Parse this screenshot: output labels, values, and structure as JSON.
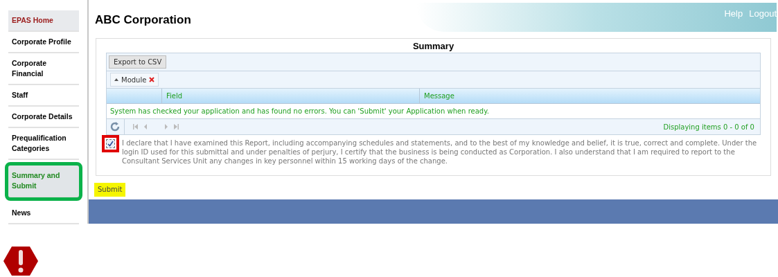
{
  "nav": [
    {
      "label": "EPAS Home",
      "kind": "home",
      "selected": false,
      "highlighted": false
    },
    {
      "label": "Corporate Profile",
      "kind": "page",
      "selected": false,
      "highlighted": false
    },
    {
      "label": "Corporate Financial",
      "kind": "page",
      "selected": false,
      "highlighted": false
    },
    {
      "label": "Staff",
      "kind": "page",
      "selected": false,
      "highlighted": false
    },
    {
      "label": "Corporate Details",
      "kind": "page",
      "selected": false,
      "highlighted": false
    },
    {
      "label": "Prequalification Categories",
      "kind": "page",
      "selected": false,
      "highlighted": false
    },
    {
      "label": "Summary and Submit",
      "kind": "page",
      "selected": true,
      "highlighted": true
    },
    {
      "label": "News",
      "kind": "page",
      "selected": false,
      "highlighted": false
    }
  ],
  "header": {
    "title": "ABC Corporation",
    "links": [
      "Help",
      "Logout"
    ]
  },
  "summary": {
    "title": "Summary",
    "export_button": "Export to CSV",
    "group_chip": "Module",
    "columns": [
      "Field",
      "Message"
    ],
    "message": "System has checked your application and has found no errors. You can 'Submit' your Application when ready.",
    "pager_status": "Displaying items 0 - 0 of 0"
  },
  "declaration": {
    "checked": true,
    "highlighted": true,
    "text": "I declare that I have examined this Report, including accompanying schedules and statements, and to the best of my knowledge and belief, it is true, correct and complete. Under the login ID used for this submittal and under penalties of perjury, I certify that the business is being conducted as Corporation. I also understand that I am required to report to the Consultant Services Unit any changes in key personnel within 15 working days of the change."
  },
  "submit": {
    "label": "Submit",
    "highlighted": true
  }
}
